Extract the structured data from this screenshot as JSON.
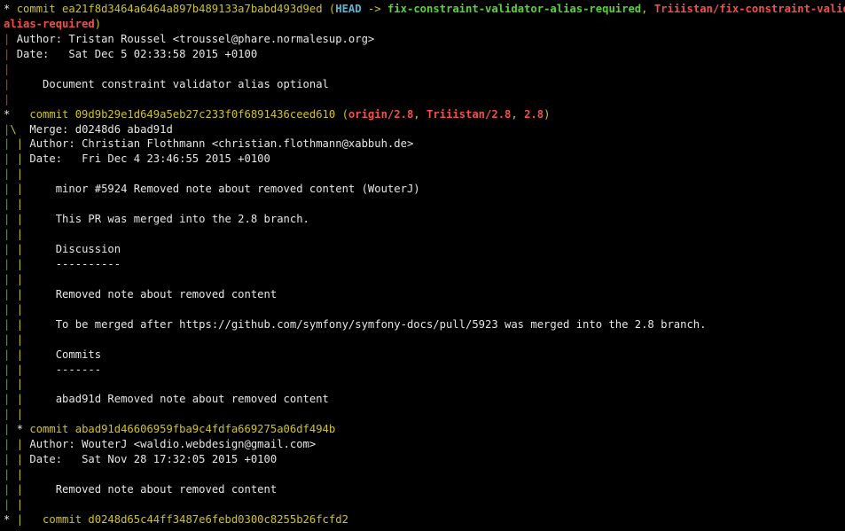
{
  "colors": {
    "graph_red": "#d8302b",
    "graph_green": "#43b02a",
    "graph_yellow": "#c8c51e",
    "commit_hash": "#d2c41d",
    "head": "#4fb8d8",
    "local_branch": "#57d23b",
    "remote_branch": "#f0504a",
    "text": "#e6e6e6",
    "background": "#000000"
  },
  "lines": [
    {
      "segments": [
        {
          "t": "* ",
          "c": "g-star"
        },
        {
          "t": "commit ea21f8d3464a6464a897b489133a7babd493d9ed",
          "c": "c-yellow"
        },
        {
          "t": " (",
          "c": "c-yellow"
        },
        {
          "t": "HEAD",
          "c": "c-head"
        },
        {
          "t": " -> ",
          "c": "c-yellow"
        },
        {
          "t": "fix-constraint-validator-alias-required",
          "c": "c-green"
        },
        {
          "t": ", ",
          "c": "c-yellow"
        },
        {
          "t": "Triiistan/fix-constraint-validator-",
          "c": "c-red"
        }
      ]
    },
    {
      "segments": [
        {
          "t": "alias-required",
          "c": "c-red"
        },
        {
          "t": ")",
          "c": "c-yellow"
        }
      ]
    },
    {
      "segments": [
        {
          "t": "| ",
          "c": "g-red"
        },
        {
          "t": "Author: Tristan Roussel <troussel@phare.normalesup.org>",
          "c": "c-white"
        }
      ]
    },
    {
      "segments": [
        {
          "t": "| ",
          "c": "g-red"
        },
        {
          "t": "Date:   Sat Dec 5 02:33:58 2015 +0100",
          "c": "c-white"
        }
      ]
    },
    {
      "segments": [
        {
          "t": "|",
          "c": "g-red"
        }
      ]
    },
    {
      "segments": [
        {
          "t": "| ",
          "c": "g-red"
        },
        {
          "t": "    Document constraint validator alias optional",
          "c": "c-white"
        }
      ]
    },
    {
      "segments": [
        {
          "t": "|",
          "c": "g-red"
        }
      ]
    },
    {
      "segments": [
        {
          "t": "*   ",
          "c": "g-star"
        },
        {
          "t": "commit 09d9b29e1d649a5eb27c233f0f6891436ceed610",
          "c": "c-yellow"
        },
        {
          "t": " (",
          "c": "c-yellow"
        },
        {
          "t": "origin/2.8",
          "c": "c-red"
        },
        {
          "t": ", ",
          "c": "c-yellow"
        },
        {
          "t": "Triiistan/2.8",
          "c": "c-red"
        },
        {
          "t": ", ",
          "c": "c-yellow"
        },
        {
          "t": "2.8",
          "c": "c-red"
        },
        {
          "t": ")",
          "c": "c-yellow"
        }
      ]
    },
    {
      "segments": [
        {
          "t": "|",
          "c": "g-green"
        },
        {
          "t": "\\ ",
          "c": "g-yellow"
        },
        {
          "t": " Merge: d0248d6 abad91d",
          "c": "c-white"
        }
      ]
    },
    {
      "segments": [
        {
          "t": "| ",
          "c": "g-green"
        },
        {
          "t": "| ",
          "c": "g-yellow"
        },
        {
          "t": "Author: Christian Flothmann <christian.flothmann@xabbuh.de>",
          "c": "c-white"
        }
      ]
    },
    {
      "segments": [
        {
          "t": "| ",
          "c": "g-green"
        },
        {
          "t": "| ",
          "c": "g-yellow"
        },
        {
          "t": "Date:   Fri Dec 4 23:46:55 2015 +0100",
          "c": "c-white"
        }
      ]
    },
    {
      "segments": [
        {
          "t": "| ",
          "c": "g-green"
        },
        {
          "t": "|",
          "c": "g-yellow"
        }
      ]
    },
    {
      "segments": [
        {
          "t": "| ",
          "c": "g-green"
        },
        {
          "t": "| ",
          "c": "g-yellow"
        },
        {
          "t": "    minor #5924 Removed note about removed content (WouterJ)",
          "c": "c-white"
        }
      ]
    },
    {
      "segments": [
        {
          "t": "| ",
          "c": "g-green"
        },
        {
          "t": "|",
          "c": "g-yellow"
        }
      ]
    },
    {
      "segments": [
        {
          "t": "| ",
          "c": "g-green"
        },
        {
          "t": "| ",
          "c": "g-yellow"
        },
        {
          "t": "    This PR was merged into the 2.8 branch.",
          "c": "c-white"
        }
      ]
    },
    {
      "segments": [
        {
          "t": "| ",
          "c": "g-green"
        },
        {
          "t": "|",
          "c": "g-yellow"
        }
      ]
    },
    {
      "segments": [
        {
          "t": "| ",
          "c": "g-green"
        },
        {
          "t": "| ",
          "c": "g-yellow"
        },
        {
          "t": "    Discussion",
          "c": "c-white"
        }
      ]
    },
    {
      "segments": [
        {
          "t": "| ",
          "c": "g-green"
        },
        {
          "t": "| ",
          "c": "g-yellow"
        },
        {
          "t": "    ----------",
          "c": "c-white"
        }
      ]
    },
    {
      "segments": [
        {
          "t": "| ",
          "c": "g-green"
        },
        {
          "t": "|",
          "c": "g-yellow"
        }
      ]
    },
    {
      "segments": [
        {
          "t": "| ",
          "c": "g-green"
        },
        {
          "t": "| ",
          "c": "g-yellow"
        },
        {
          "t": "    Removed note about removed content",
          "c": "c-white"
        }
      ]
    },
    {
      "segments": [
        {
          "t": "| ",
          "c": "g-green"
        },
        {
          "t": "|",
          "c": "g-yellow"
        }
      ]
    },
    {
      "segments": [
        {
          "t": "| ",
          "c": "g-green"
        },
        {
          "t": "| ",
          "c": "g-yellow"
        },
        {
          "t": "    To be merged after https://github.com/symfony/symfony-docs/pull/5923 was merged into the 2.8 branch.",
          "c": "c-white"
        }
      ]
    },
    {
      "segments": [
        {
          "t": "| ",
          "c": "g-green"
        },
        {
          "t": "|",
          "c": "g-yellow"
        }
      ]
    },
    {
      "segments": [
        {
          "t": "| ",
          "c": "g-green"
        },
        {
          "t": "| ",
          "c": "g-yellow"
        },
        {
          "t": "    Commits",
          "c": "c-white"
        }
      ]
    },
    {
      "segments": [
        {
          "t": "| ",
          "c": "g-green"
        },
        {
          "t": "| ",
          "c": "g-yellow"
        },
        {
          "t": "    -------",
          "c": "c-white"
        }
      ]
    },
    {
      "segments": [
        {
          "t": "| ",
          "c": "g-green"
        },
        {
          "t": "|",
          "c": "g-yellow"
        }
      ]
    },
    {
      "segments": [
        {
          "t": "| ",
          "c": "g-green"
        },
        {
          "t": "| ",
          "c": "g-yellow"
        },
        {
          "t": "    abad91d Removed note about removed content",
          "c": "c-white"
        }
      ]
    },
    {
      "segments": [
        {
          "t": "| ",
          "c": "g-green"
        },
        {
          "t": "|",
          "c": "g-yellow"
        }
      ]
    },
    {
      "segments": [
        {
          "t": "| ",
          "c": "g-green"
        },
        {
          "t": "* ",
          "c": "g-star"
        },
        {
          "t": "commit abad91d46606959fba9c4fdfa669275a06df494b",
          "c": "c-yellow"
        }
      ]
    },
    {
      "segments": [
        {
          "t": "| ",
          "c": "g-green"
        },
        {
          "t": "| ",
          "c": "g-yellow"
        },
        {
          "t": "Author: WouterJ <waldio.webdesign@gmail.com>",
          "c": "c-white"
        }
      ]
    },
    {
      "segments": [
        {
          "t": "| ",
          "c": "g-green"
        },
        {
          "t": "| ",
          "c": "g-yellow"
        },
        {
          "t": "Date:   Sat Nov 28 17:32:05 2015 +0100",
          "c": "c-white"
        }
      ]
    },
    {
      "segments": [
        {
          "t": "| ",
          "c": "g-green"
        },
        {
          "t": "|",
          "c": "g-yellow"
        }
      ]
    },
    {
      "segments": [
        {
          "t": "| ",
          "c": "g-green"
        },
        {
          "t": "| ",
          "c": "g-yellow"
        },
        {
          "t": "    Removed note about removed content",
          "c": "c-white"
        }
      ]
    },
    {
      "segments": [
        {
          "t": "| ",
          "c": "g-green"
        },
        {
          "t": "|",
          "c": "g-yellow"
        }
      ]
    },
    {
      "segments": [
        {
          "t": "* ",
          "c": "g-star"
        },
        {
          "t": "| ",
          "c": "g-yellow"
        },
        {
          "t": "  commit d0248d65c44ff3487e6febd0300c8255b26fcfd2",
          "c": "c-yellow"
        }
      ]
    }
  ]
}
